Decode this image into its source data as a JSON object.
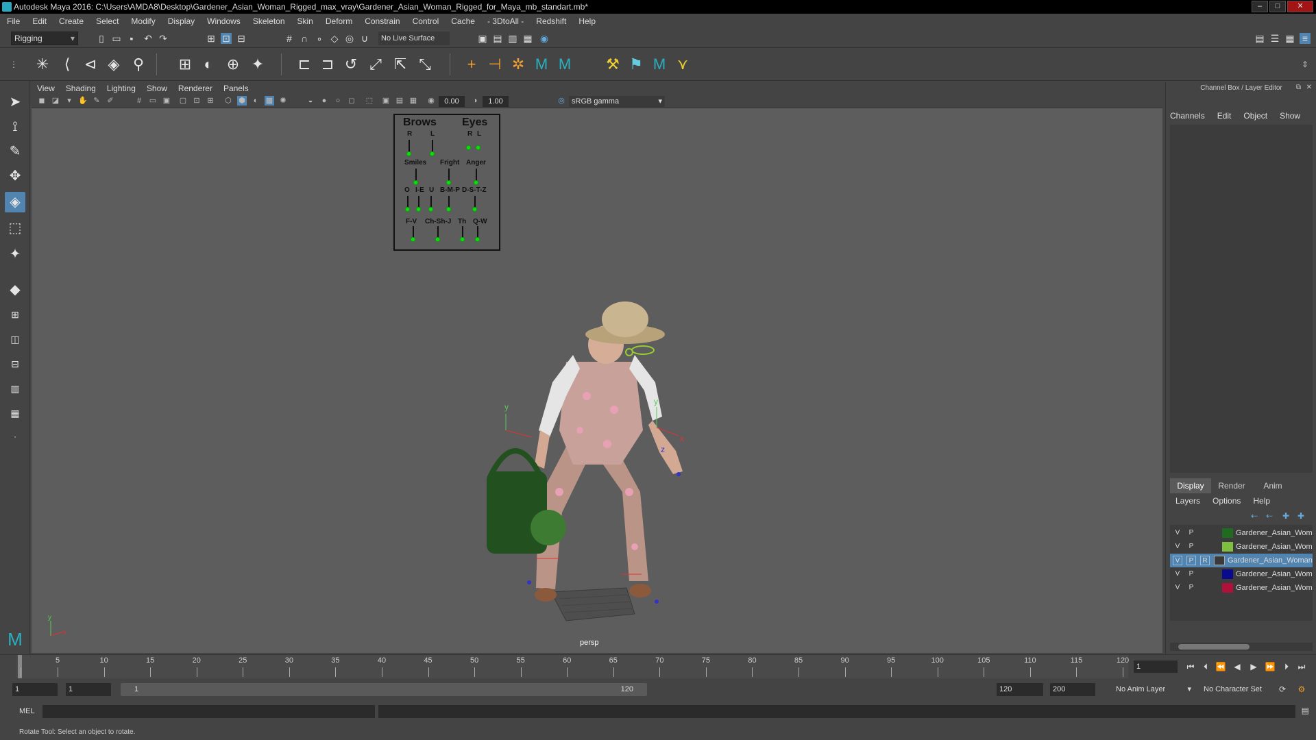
{
  "window": {
    "title": "Autodesk Maya 2016: C:\\Users\\AMDA8\\Desktop\\Gardener_Asian_Woman_Rigged_max_vray\\Gardener_Asian_Woman_Rigged_for_Maya_mb_standart.mb*",
    "minimize": "–",
    "maximize": "□",
    "close": "✕"
  },
  "menu": [
    "File",
    "Edit",
    "Create",
    "Select",
    "Modify",
    "Display",
    "Windows",
    "Skeleton",
    "Skin",
    "Deform",
    "Constrain",
    "Control",
    "Cache",
    "- 3DtoAll -",
    "Redshift",
    "Help"
  ],
  "statusline": {
    "mode": "Rigging",
    "live_surface": "No Live Surface"
  },
  "viewport": {
    "menu": [
      "View",
      "Shading",
      "Lighting",
      "Show",
      "Renderer",
      "Panels"
    ],
    "exposure": "0.00",
    "gamma": "1.00",
    "color_space": "sRGB gamma",
    "camera": "persp",
    "axis_y": "y",
    "axis_x": "x",
    "axis_z": "z"
  },
  "face_board": {
    "brows": "Brows",
    "eyes": "Eyes",
    "r1": "R",
    "l1": "L",
    "r2": "R",
    "l2": "L",
    "smiles": "Smiles",
    "fright": "Fright",
    "anger": "Anger",
    "p_o": "O",
    "p_e": "I-E",
    "p_u": "U",
    "p_bmp": "B-M-P",
    "p_dstz": "D-S-T-Z",
    "p_fv": "F-V",
    "p_chshj": "Ch-Sh-J",
    "p_th": "Th",
    "p_qw": "Q-W"
  },
  "channel_box": {
    "header": "Channel Box / Layer Editor",
    "tabs": [
      "Channels",
      "Edit",
      "Object",
      "Show"
    ]
  },
  "layer_editor": {
    "tabs": [
      "Display",
      "Render",
      "Anim"
    ],
    "active_tab": "Display",
    "menu": [
      "Layers",
      "Options",
      "Help"
    ],
    "layers": [
      {
        "v": "V",
        "p": "P",
        "r": "",
        "color": "#1f6b1f",
        "name": "Gardener_Asian_Wom"
      },
      {
        "v": "V",
        "p": "P",
        "r": "",
        "color": "#7fbf3f",
        "name": "Gardener_Asian_Wom"
      },
      {
        "v": "V",
        "p": "P",
        "r": "R",
        "color": "#3a3a3a",
        "name": "Gardener_Asian_Woman",
        "selected": true
      },
      {
        "v": "V",
        "p": "P",
        "r": "",
        "color": "#0a0a8f",
        "name": "Gardener_Asian_Wom"
      },
      {
        "v": "V",
        "p": "P",
        "r": "",
        "color": "#b0103a",
        "name": "Gardener_Asian_Wom"
      }
    ]
  },
  "timeline": {
    "ticks": [
      "1",
      "5",
      "10",
      "15",
      "20",
      "25",
      "30",
      "35",
      "40",
      "45",
      "50",
      "55",
      "60",
      "65",
      "70",
      "75",
      "80",
      "85",
      "90",
      "95",
      "100",
      "105",
      "110",
      "115",
      "120"
    ],
    "current_frame": "1"
  },
  "range": {
    "start": "1",
    "anim_start": "1",
    "slider_start": "1",
    "slider_end": "120",
    "anim_end": "120",
    "end": "200",
    "anim_layer": "No Anim Layer",
    "character_set": "No Character Set"
  },
  "command": {
    "label": "MEL"
  },
  "help": {
    "text": "Rotate Tool: Select an object to rotate."
  }
}
